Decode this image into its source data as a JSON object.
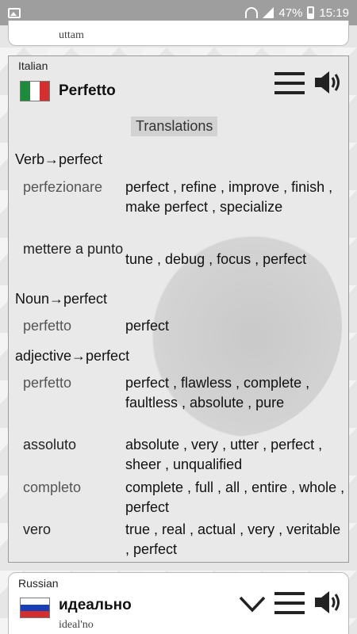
{
  "status_bar": {
    "battery": "47%",
    "time": "15:19"
  },
  "top_card": {
    "transliteration": "uttam"
  },
  "main_card": {
    "language": "Italian",
    "word": "Perfetto",
    "section_title": "Translations",
    "groups": [
      {
        "pos": "Verb→perfect",
        "entries": [
          {
            "word": "perfezionare",
            "translations": "perfect , refine , improve , finish , make perfect , specialize"
          },
          {
            "word": "mettere a punto",
            "translations": "tune , debug , focus , perfect"
          }
        ]
      },
      {
        "pos": "Noun→perfect",
        "entries": [
          {
            "word": "perfetto",
            "translations": "perfect"
          }
        ]
      },
      {
        "pos": "adjective→perfect",
        "entries": [
          {
            "word": "perfetto",
            "translations": "perfect , flawless , complete , faultless , absolute , pure"
          },
          {
            "word": "assoluto",
            "translations": "absolute , very , utter , perfect , sheer , unqualified"
          },
          {
            "word": "completo",
            "translations": "complete , full , all , entire , whole , perfect"
          },
          {
            "word": "vero",
            "translations": "true , real , actual , very , veritable , perfect"
          }
        ]
      }
    ]
  },
  "bottom_card": {
    "language": "Russian",
    "word": "идеально",
    "transliteration": "ideal'no"
  },
  "colors": {
    "status_bar": "#9e9e9e",
    "flag_it": [
      "#1e8b3a",
      "#ffffff",
      "#d32f2f"
    ],
    "flag_ru": [
      "#ffffff",
      "#1a3fb4",
      "#d32f2f"
    ]
  },
  "icons": [
    "image-icon",
    "wifi-icon",
    "signal-icon",
    "battery-icon",
    "menu-icon",
    "speaker-icon",
    "chevron-down-icon"
  ]
}
